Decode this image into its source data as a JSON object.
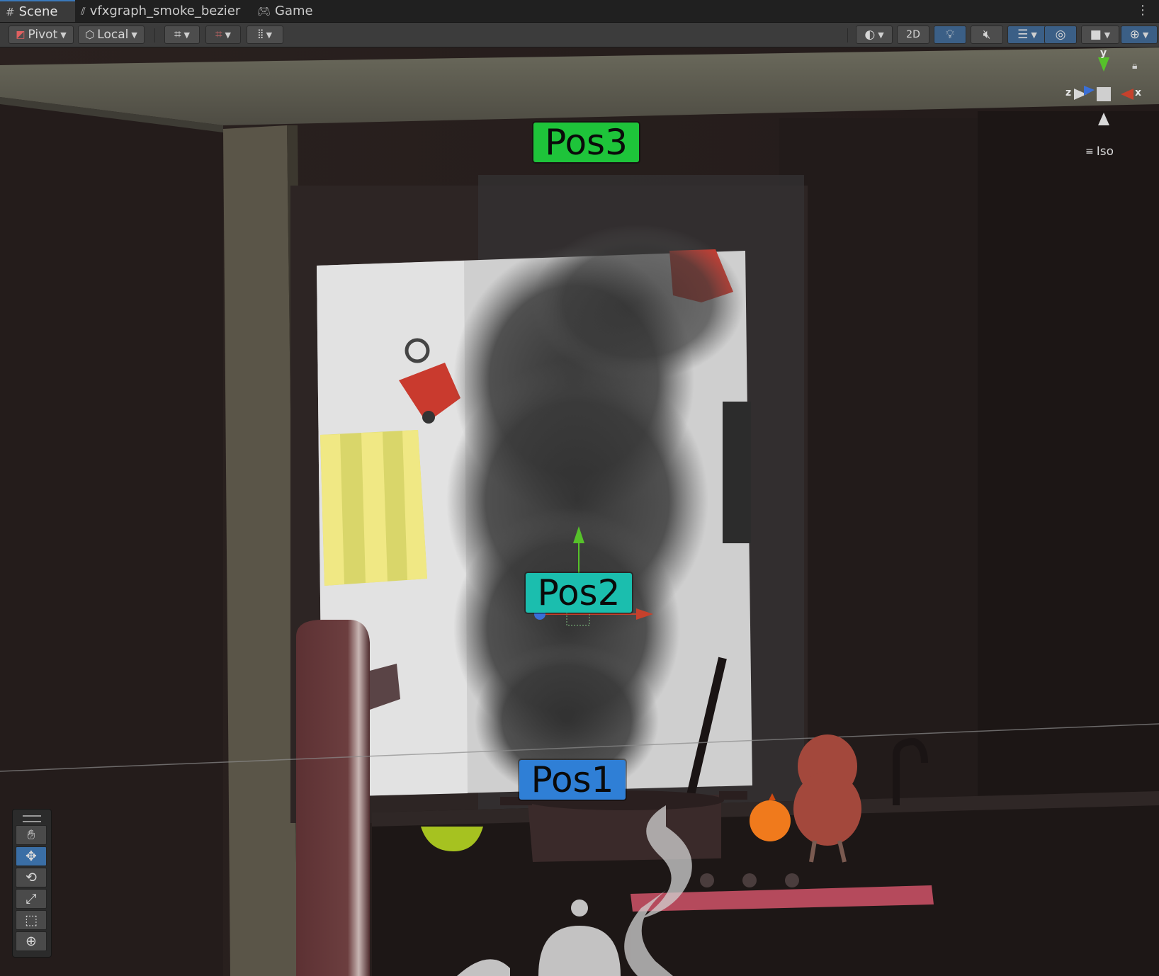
{
  "tabs": [
    {
      "label": "Scene",
      "icon": "grid-icon",
      "active": true
    },
    {
      "label": "vfxgraph_smoke_bezier",
      "icon": "vfx-graph-icon",
      "active": false
    },
    {
      "label": "Game",
      "icon": "gamepad-icon",
      "active": false
    }
  ],
  "toolbar": {
    "pivot_label": "Pivot",
    "local_label": "Local",
    "mode_2d_label": "2D"
  },
  "scene": {
    "labels": [
      {
        "name": "Pos3",
        "color": "#1ec43a"
      },
      {
        "name": "Pos2",
        "color": "#1bbeae"
      },
      {
        "name": "Pos1",
        "color": "#2f7fd6"
      }
    ]
  },
  "gizmo": {
    "axis_y": "y",
    "axis_x": "x",
    "axis_z": "z",
    "projection_label": "Iso"
  },
  "tools": [
    {
      "name": "hand-tool",
      "icon": "hand-icon",
      "active": false
    },
    {
      "name": "move-tool",
      "icon": "move-icon",
      "active": true
    },
    {
      "name": "rotate-tool",
      "icon": "rotate-icon",
      "active": false
    },
    {
      "name": "scale-tool",
      "icon": "scale-icon",
      "active": false
    },
    {
      "name": "rect-tool",
      "icon": "rect-icon",
      "active": false
    },
    {
      "name": "transform-tool",
      "icon": "transform-icon",
      "active": false
    }
  ],
  "colors": {
    "axis_x": "#c6412c",
    "axis_y": "#56c12a",
    "axis_z": "#3a6fd6",
    "accent": "#3b5f86"
  }
}
